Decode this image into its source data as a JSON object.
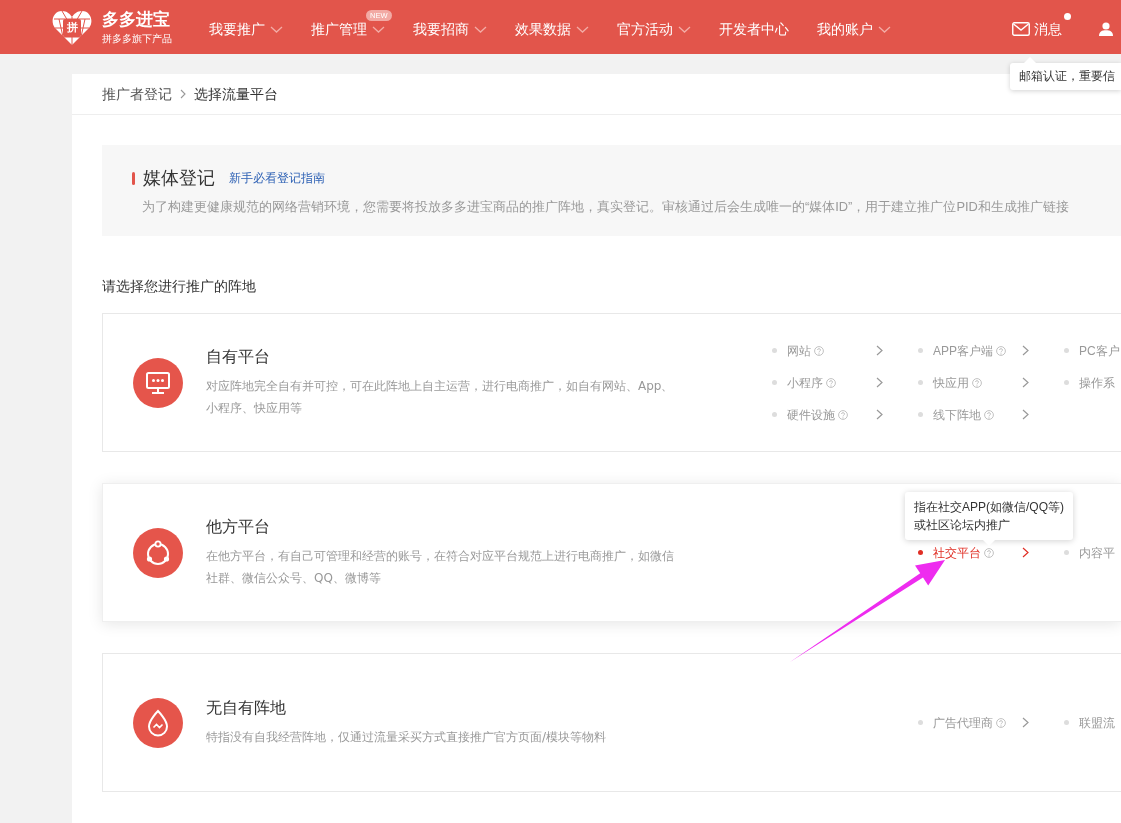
{
  "header": {
    "logo": {
      "mark": "拼",
      "title": "多多进宝",
      "subtitle": "拼多多旗下产品"
    },
    "nav": [
      {
        "label": "我要推广",
        "dropdown": true
      },
      {
        "label": "推广管理",
        "dropdown": true,
        "badge": "NEW"
      },
      {
        "label": "我要招商",
        "dropdown": true
      },
      {
        "label": "效果数据",
        "dropdown": true
      },
      {
        "label": "官方活动",
        "dropdown": true
      },
      {
        "label": "开发者中心",
        "dropdown": false
      },
      {
        "label": "我的账户",
        "dropdown": true
      }
    ],
    "messages": {
      "label": "消息",
      "unread": true
    },
    "notice": "邮箱认证，重要信"
  },
  "breadcrumb": [
    {
      "label": "推广者登记"
    },
    {
      "label": "选择流量平台"
    }
  ],
  "intro": {
    "title": "媒体登记",
    "guide_link": "新手必看登记指南",
    "description": "为了构建更健康规范的网络营销环境，您需要将投放多多进宝商品的推广阵地，真实登记。审核通过后会生成唯一的“媒体ID”，用于建立推广位PID和生成推广链接"
  },
  "prompt": "请选择您进行推广的阵地",
  "platforms": [
    {
      "kind": "screen",
      "title": "自有平台",
      "description": "对应阵地完全自有并可控，可在此阵地上自主运营，进行电商推广，如自有网站、App、小程序、快应用等",
      "hovered": false,
      "options": [
        {
          "label": "网站",
          "selected": false,
          "clipped": false
        },
        {
          "label": "APP客户端",
          "selected": false,
          "clipped": false
        },
        {
          "label": "PC客户",
          "selected": false,
          "clipped": true
        },
        {
          "label": "小程序",
          "selected": false,
          "clipped": false
        },
        {
          "label": "快应用",
          "selected": false,
          "clipped": false
        },
        {
          "label": "操作系",
          "selected": false,
          "clipped": true
        },
        {
          "label": "硬件设施",
          "selected": false,
          "clipped": false
        },
        {
          "label": "线下阵地",
          "selected": false,
          "clipped": false
        }
      ]
    },
    {
      "kind": "network",
      "title": "他方平台",
      "description": "在他方平台，有自己可管理和经营的账号，在符合对应平台规范上进行电商推广，如微信社群、微信公众号、QQ、微博等",
      "hovered": true,
      "options": [
        {
          "label": "社交平台",
          "selected": true,
          "clipped": false,
          "tooltip": "指在社交APP(如微信/QQ等)\n或社区论坛内推广"
        },
        {
          "label": "内容平",
          "selected": false,
          "clipped": true
        }
      ]
    },
    {
      "kind": "drop",
      "title": "无自有阵地",
      "description": "特指没有自我经营阵地，仅通过流量采买方式直接推广官方页面/模块等物料",
      "hovered": false,
      "options": [
        {
          "label": "广告代理商",
          "selected": false,
          "clipped": false
        },
        {
          "label": "联盟流",
          "selected": false,
          "clipped": true
        }
      ]
    }
  ]
}
